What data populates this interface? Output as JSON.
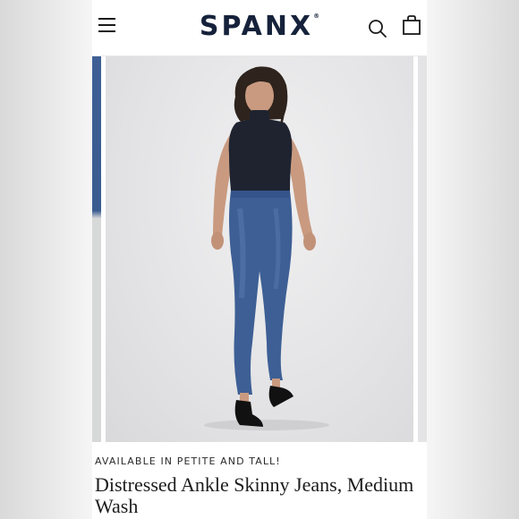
{
  "header": {
    "brand": "SPANX",
    "brand_mark": "®",
    "menu_icon": "hamburger-menu-icon",
    "search_icon": "search-icon",
    "bag_icon": "shopping-bag-icon"
  },
  "product": {
    "eyebrow": "AVAILABLE IN PETITE AND TALL!",
    "title": "Distressed Ankle Skinny Jeans, Medium Wash"
  },
  "colors": {
    "brand": "#16223b",
    "denim": "#3d5f95",
    "top": "#1f2330"
  }
}
